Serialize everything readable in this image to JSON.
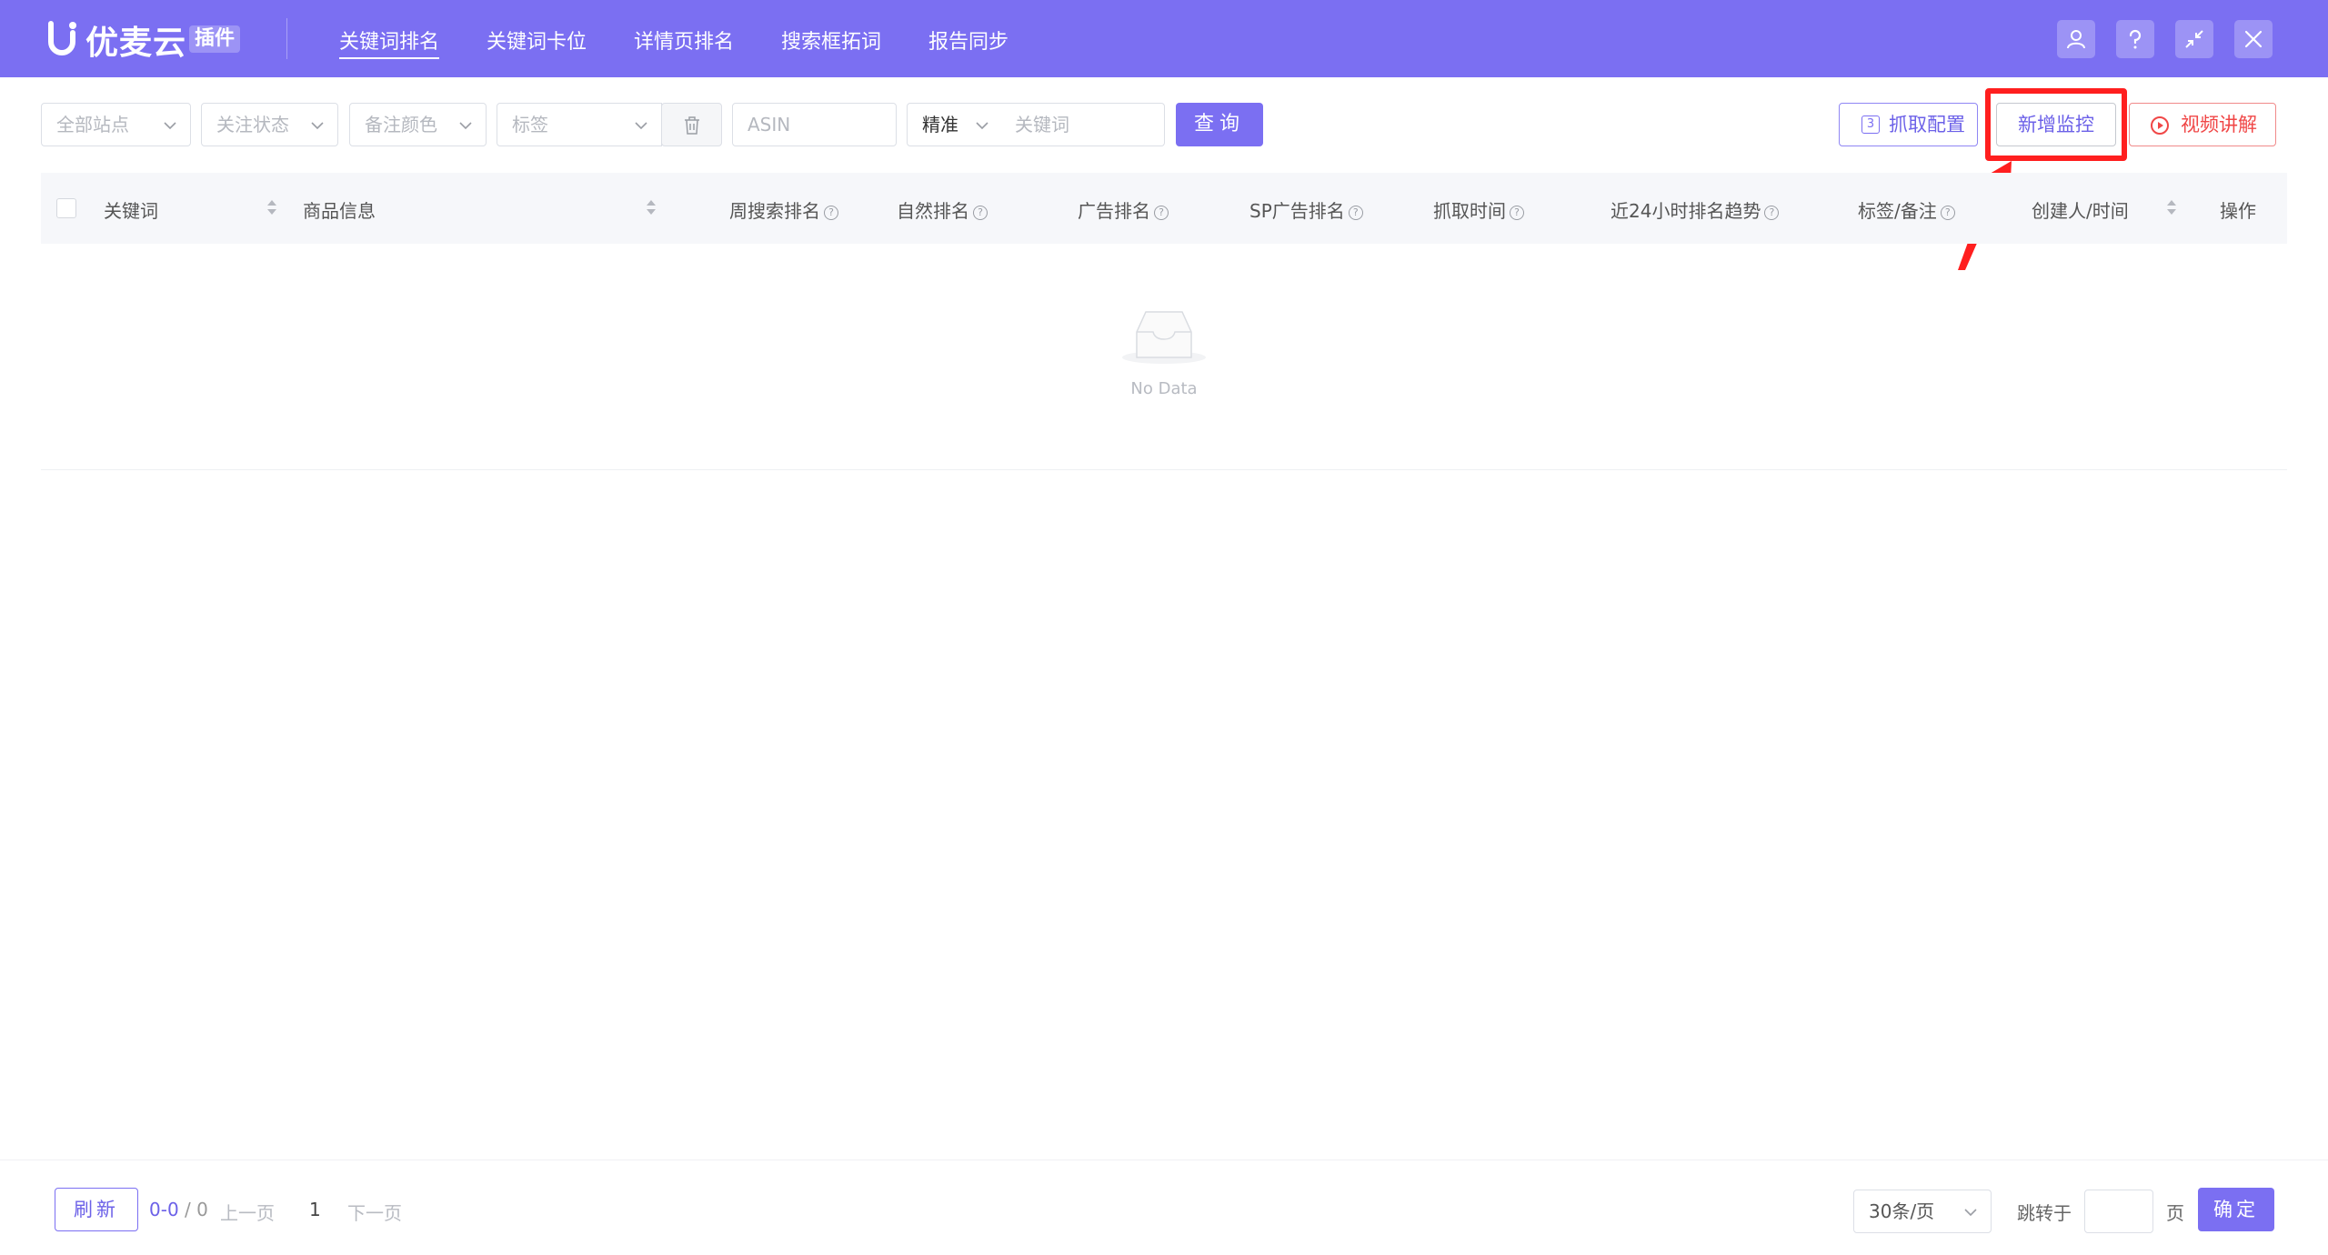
{
  "app": {
    "name": "优麦云",
    "badge": "插件"
  },
  "nav": [
    {
      "label": "关键词排名",
      "active": true
    },
    {
      "label": "关键词卡位",
      "active": false
    },
    {
      "label": "详情页排名",
      "active": false
    },
    {
      "label": "搜索框拓词",
      "active": false
    },
    {
      "label": "报告同步",
      "active": false
    }
  ],
  "window_controls": [
    "user-icon",
    "help-icon",
    "collapse-icon",
    "close-icon"
  ],
  "filters": {
    "site": "全部站点",
    "follow_status": "关注状态",
    "note_color": "备注颜色",
    "tag": "标签",
    "asin_placeholder": "ASIN",
    "match_mode": "精准",
    "keyword_placeholder": "关键词",
    "query_label": "查询"
  },
  "actions": {
    "config_label": "抓取配置",
    "config_count": "3",
    "add_monitor_label": "新增监控",
    "video_label": "视频讲解"
  },
  "table": {
    "columns": [
      "关键词",
      "商品信息",
      "周搜索排名",
      "自然排名",
      "广告排名",
      "SP广告排名",
      "抓取时间",
      "近24小时排名趋势",
      "标签/备注",
      "创建人/时间",
      "操作"
    ],
    "empty_text": "No Data"
  },
  "pagination": {
    "refresh_label": "刷新",
    "range": "0-0",
    "total": "/ 0",
    "prev": "上一页",
    "page": "1",
    "next": "下一页",
    "page_size": "30条/页",
    "jump_label": "跳转于",
    "page_unit": "页",
    "confirm_label": "确定"
  },
  "colors": {
    "brand": "#7b6ff2",
    "highlight": "#ff1f1f",
    "danger": "#f04747"
  }
}
